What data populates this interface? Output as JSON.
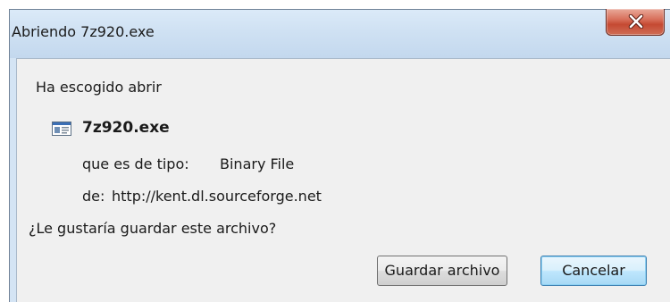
{
  "dialog": {
    "title": "Abriendo 7z920.exe",
    "intro": "Ha escogido abrir",
    "file_name": "7z920.exe",
    "type_label": "que es de tipo:",
    "type_value": "Binary File",
    "from_label": "de:",
    "from_value": "http://kent.dl.sourceforge.net",
    "question": "¿Le gustaría guardar este archivo?",
    "save_label": "Guardar archivo",
    "cancel_label": "Cancelar"
  },
  "icons": {
    "close": "close-icon",
    "file": "executable-file-icon"
  },
  "colors": {
    "close_button": "#c54a33",
    "dialog_body": "#f0f0f0",
    "title_bar": "#cfe1f3"
  }
}
